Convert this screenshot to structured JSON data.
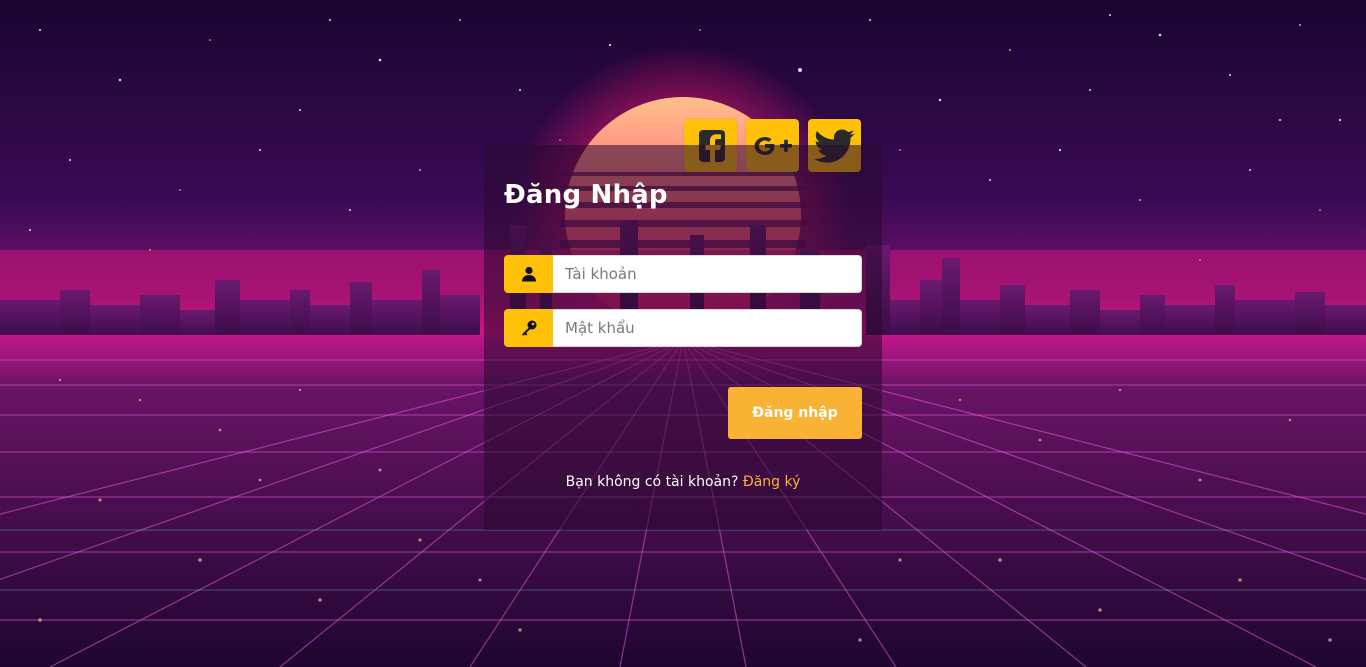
{
  "colors": {
    "accent": "#ffc107",
    "button": "#f9b233",
    "link": "#f9b233",
    "card_bg": "rgba(40,10,45,0.55)"
  },
  "social": [
    {
      "name": "facebook",
      "icon": "facebook-icon"
    },
    {
      "name": "google-plus",
      "icon": "google-plus-icon"
    },
    {
      "name": "twitter",
      "icon": "twitter-icon"
    }
  ],
  "login": {
    "title": "Đăng Nhập",
    "username_placeholder": "Tài khoản",
    "username_icon": "user-icon",
    "password_placeholder": "Mật khẩu",
    "password_icon": "key-icon",
    "submit_label": "Đăng nhập",
    "signup_prompt": "Bạn không có tài khoản?",
    "signup_link": "Đăng ký"
  }
}
